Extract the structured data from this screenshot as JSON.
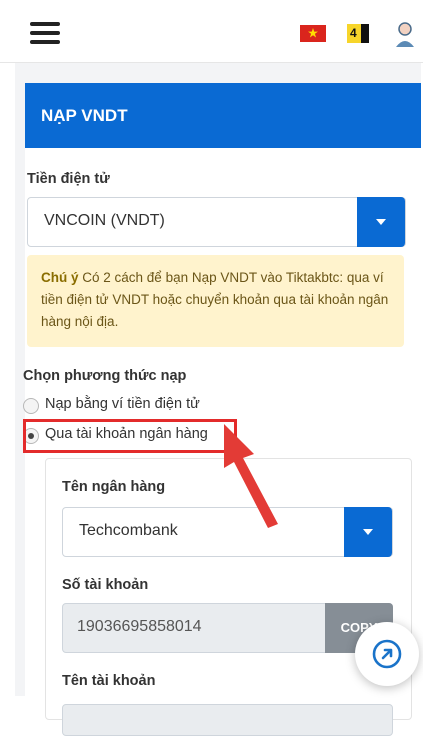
{
  "header": {
    "menu_icon": "hamburger-menu-icon",
    "flag_icon": "vietnam-flag-icon",
    "badge_text": "4",
    "avatar_icon": "user-avatar-icon"
  },
  "deposit": {
    "title": "NẠP VNDT",
    "crypto_label": "Tiền điện tử",
    "crypto_value": "VNCOIN (VNDT)",
    "note_strong": "Chú ý",
    "note_text": " Có 2 cách để bạn Nạp VNDT vào Tiktakbtc: qua ví tiền điện tử VNDT hoặc chuyển khoản qua tài khoản ngân hàng nội địa.",
    "method_label": "Chọn phương thức nạp",
    "methods": [
      {
        "label": "Nạp bằng ví tiền điện tử",
        "selected": false
      },
      {
        "label": "Qua tài khoản ngân hàng",
        "selected": true
      }
    ],
    "bank_name_label": "Tên ngân hàng",
    "bank_name_value": "Techcombank",
    "account_number_label": "Số tài khoản",
    "account_number_value": "19036695858014",
    "copy_label": "COPY",
    "account_name_label": "Tên tài khoản"
  },
  "colors": {
    "primary": "#0a6ad3",
    "note_bg": "#fff3cd",
    "annotation": "#e32b2b"
  },
  "fab_icon": "external-link-icon"
}
